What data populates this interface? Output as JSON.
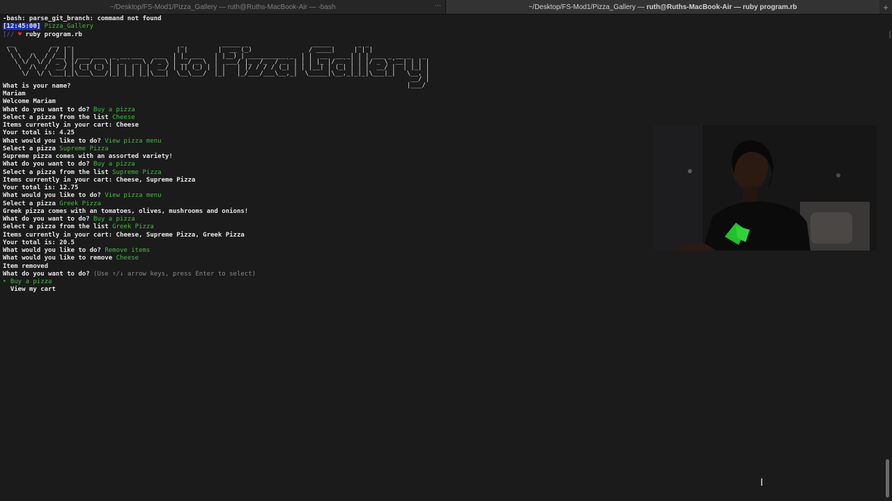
{
  "tabs": [
    {
      "label": "~/Desktop/FS-Mod1/Pizza_Gallery — ruth@Ruths-MacBook-Air — -bash",
      "active": false
    },
    {
      "label_prefix": "~/Desktop/FS-Mod1/Pizza_Gallery — ",
      "label_bold": "ruth@Ruths-MacBook-Air — ruby program.rb",
      "active": true
    }
  ],
  "new_tab_symbol": "+",
  "terminal": {
    "error_line": "-bash: parse_git_branch: command not found",
    "timestamp": "[12:45:00]",
    "cwd": "Pizza_Gallery",
    "prompt_prefix": "[//",
    "prompt_heart": "♥",
    "command": "ruby program.rb",
    "banner": " __          __  _                             _          _____ _                 _____       _ _                  \n \\ \\        / / | |                           | |        |  __ (_)               / ____|     | | |                 \n  \\ \\  /\\  / /__| | ___ ___  _ __ ___   ___  | |_ ___   | |__) | __________ _  | |  __  __ _| | | ___ _ __ _   _ \n   \\ \\/  \\/ / _ \\ |/ __/ _ \\| '_ ` _ \\ / _ \\ | __/ _ \\  |  ___/ |_  /_  / _` | | | |_ |/ _` | | |/ _ \\ '__| | | |\n    \\  /\\  /  __/ | (_| (_) | | | | | |  __/ | || (_) | | |   | |/ / / / (_| | | |__| | (_| | | |  __/ |  | |_| |\n     \\/  \\/ \\___|_|\\___\\___/|_| |_| |_|\\___|  \\__\\___/  |_|   |_/___/___\\__,_|  \\_____|\\__,_|_|_|\\___|_|   \\__, |\n                                                                                                            __/ |\n                                                                                                           |___/ ",
    "lines": [
      {
        "plain": "What is your name?",
        "green": ""
      },
      {
        "plain": "Mariam",
        "green": ""
      },
      {
        "plain": "Welcome Mariam",
        "green": ""
      },
      {
        "plain": "What do you want to do? ",
        "green": "Buy a pizza"
      },
      {
        "plain": "Select a pizza from the list ",
        "green": "Cheese"
      },
      {
        "plain": "Items currently in your cart: Cheese",
        "green": ""
      },
      {
        "plain": "Your total is: 4.25",
        "green": ""
      },
      {
        "plain": "What would you like to do? ",
        "green": "View pizza menu"
      },
      {
        "plain": "Select a pizza ",
        "green": "Supreme Pizza"
      },
      {
        "plain": "Supreme pizza comes with an assorted variety!",
        "green": ""
      },
      {
        "plain": "What do you want to do? ",
        "green": "Buy a pizza"
      },
      {
        "plain": "Select a pizza from the list ",
        "green": "Supreme Pizza"
      },
      {
        "plain": "Items currently in your cart: Cheese, Supreme Pizza",
        "green": ""
      },
      {
        "plain": "Your total is: 12.75",
        "green": ""
      },
      {
        "plain": "What would you like to do? ",
        "green": "View pizza menu"
      },
      {
        "plain": "Select a pizza ",
        "green": "Greek Pizza"
      },
      {
        "plain": "Greek pizza comes with an tomatoes, olives, mushrooms and onions!",
        "green": ""
      },
      {
        "plain": "What do you want to do? ",
        "green": "Buy a pizza"
      },
      {
        "plain": "Select a pizza from the list ",
        "green": "Greek Pizza"
      },
      {
        "plain": "Items currently in your cart: Cheese, Supreme Pizza, Greek Pizza",
        "green": ""
      },
      {
        "plain": "Your total is: 20.5",
        "green": ""
      },
      {
        "plain": "What would you like to do? ",
        "green": "Remove items"
      },
      {
        "plain": "What would you like to remove ",
        "green": "Cheese"
      },
      {
        "plain": "Item removed",
        "green": ""
      }
    ],
    "menu_question": "What do you want to do? ",
    "menu_hint": "(Use ↑/↓ arrow keys, press Enter to select)",
    "menu_options": [
      {
        "pointer": "‣ ",
        "label": "Buy a pizza",
        "selected": true
      },
      {
        "pointer": "  ",
        "label": "View my cart",
        "selected": false
      }
    ]
  },
  "colors": {
    "background": "#1b1b1b",
    "text": "#e8e8e8",
    "answer_green": "#3fbf3f",
    "hint_gray": "#8a8a8a",
    "timestamp_bg": "#1b2fb8"
  }
}
